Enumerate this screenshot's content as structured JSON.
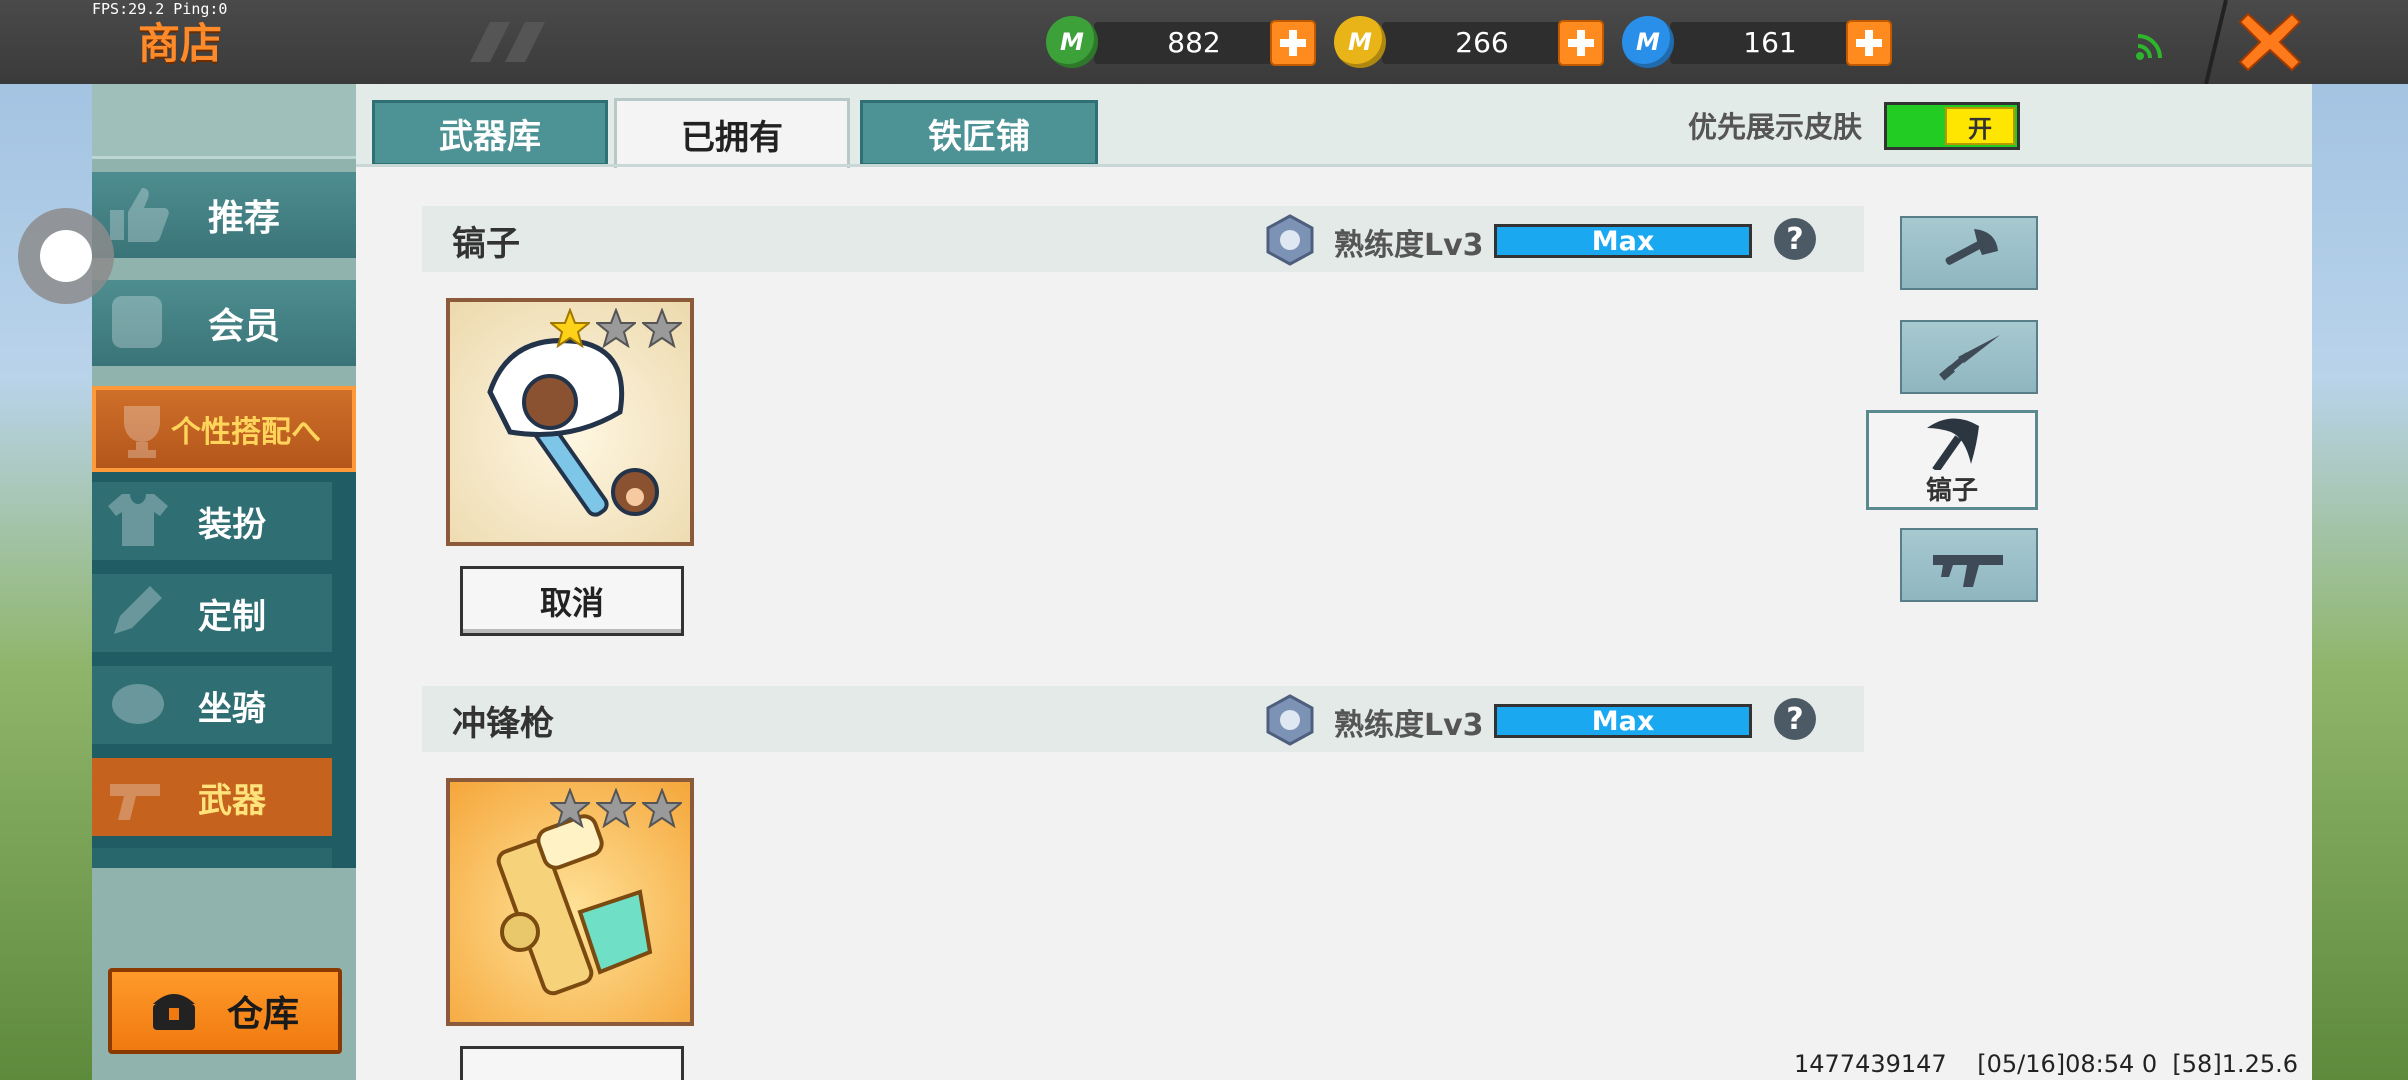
{
  "status": {
    "fps_text": "FPS:29.2  Ping:0"
  },
  "header": {
    "title": "商店"
  },
  "currencies": [
    {
      "icon": "green-mini-bean-icon",
      "value": "882",
      "color": "#3da13a"
    },
    {
      "icon": "gold-mini-coin-icon",
      "value": "266",
      "color": "#e8b417"
    },
    {
      "icon": "blue-mini-gem-icon",
      "value": "161",
      "color": "#2a8fe8"
    }
  ],
  "tabs": [
    {
      "label": "武器库",
      "active": false
    },
    {
      "label": "已拥有",
      "active": true
    },
    {
      "label": "铁匠铺",
      "active": false
    }
  ],
  "skin_toggle": {
    "label": "优先展示皮肤",
    "state": "开"
  },
  "sidebar": {
    "items": [
      {
        "label": "推荐",
        "icon": "thumbs-up-icon"
      },
      {
        "label": "会员",
        "icon": "member-badge-icon"
      },
      {
        "label": "个性搭配へ",
        "icon": "trophy-icon"
      }
    ],
    "sub_items": [
      {
        "label": "装扮",
        "icon": "shirt-icon"
      },
      {
        "label": "定制",
        "icon": "pencil-icon"
      },
      {
        "label": "坐骑",
        "icon": "mount-icon"
      },
      {
        "label": "武器",
        "icon": "revolver-icon"
      }
    ],
    "warehouse_label": "仓库"
  },
  "items": [
    {
      "name": "镐子",
      "proficiency": "熟练度Lv3",
      "bar_text": "Max",
      "bar_fill": 1.0,
      "stars_filled": 1,
      "stars_total": 3,
      "action": "取消"
    },
    {
      "name": "冲锋枪",
      "proficiency": "熟练度Lv3",
      "bar_text": "Max",
      "bar_fill": 1.0,
      "stars_filled": 0,
      "stars_total": 3
    }
  ],
  "weapon_filters": [
    {
      "icon": "axe-icon",
      "selected": false
    },
    {
      "icon": "sword-icon",
      "selected": false
    },
    {
      "icon": "pickaxe-icon",
      "label": "镐子",
      "selected": true
    },
    {
      "icon": "gun-icon",
      "selected": false
    }
  ],
  "footer": {
    "info": "1477439147    [05/16]08:54 0  [58]1.25.6"
  },
  "help_symbol": "?"
}
